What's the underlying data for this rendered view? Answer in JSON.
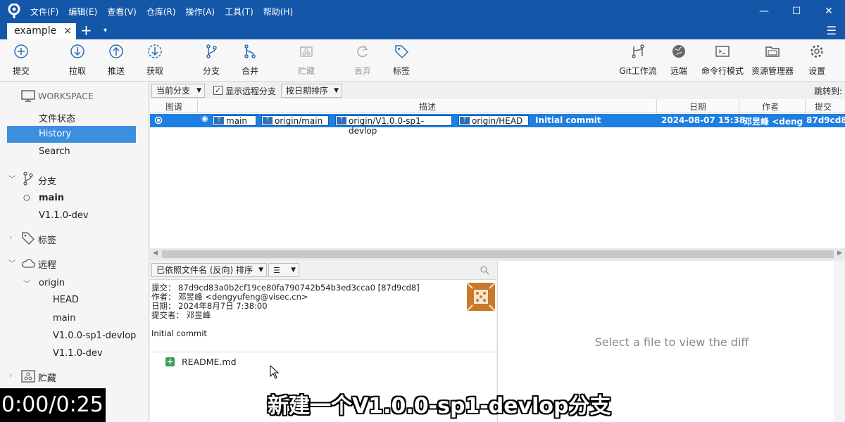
{
  "menu": [
    "文件(F)",
    "编辑(E)",
    "查看(V)",
    "仓库(R)",
    "操作(A)",
    "工具(T)",
    "帮助(H)"
  ],
  "tab": {
    "label": "example",
    "close": "×",
    "add": "+",
    "menu": "▾"
  },
  "toolbar": {
    "commit": "提交",
    "pull": "拉取",
    "push": "推送",
    "fetch": "获取",
    "branch": "分支",
    "merge": "合并",
    "stash": "贮藏",
    "discard": "丢弃",
    "tag": "标签",
    "gitflow": "Git工作流",
    "remote": "远端",
    "terminal": "命令行模式",
    "explorer": "资源管理器",
    "settings": "设置"
  },
  "sidebar": {
    "workspace": "WORKSPACE",
    "file_status": "文件状态",
    "history": "History",
    "search": "Search",
    "branches": "分支",
    "branch_items": [
      "main",
      "V1.1.0-dev"
    ],
    "tags": "标签",
    "remotes": "远程",
    "origin": "origin",
    "remote_items": [
      "HEAD",
      "main",
      "V1.0.0-sp1-devlop",
      "V1.1.0-dev"
    ],
    "stashes": "贮藏"
  },
  "filter": {
    "branch_select": "当前分支",
    "show_remote": "显示远程分支",
    "sort_select": "按日期排序",
    "jump_to": "跳转到:"
  },
  "grid": {
    "headers": {
      "graph": "图谱",
      "desc": "描述",
      "date": "日期",
      "author": "作者",
      "commit": "提交"
    },
    "row": {
      "refs": [
        "main",
        "origin/main",
        "origin/V1.0.0-sp1-devlop",
        "origin/HEAD"
      ],
      "message": "Initial commit",
      "date": "2024-08-07 15:38",
      "author": "邓昱峰 <deng",
      "hash": "87d9cd8"
    }
  },
  "details": {
    "sort_label": "已依照文件名 (反向) 排序",
    "commit_line": "提交： 87d9cd83a0b2cf19ce80fa790742b54b3ed3cca0 [87d9cd8]",
    "author_line": "作者： 邓昱峰 <dengyufeng@visec.cn>",
    "date_line": "日期： 2024年8月7日 7:38:00",
    "committer_line": "提交者： 邓昱峰",
    "message": "Initial commit",
    "file": "README.md"
  },
  "diff_placeholder": "Select a file to view the diff",
  "video": {
    "time": "0:00/0:25",
    "subtitle": "新建一个V1.0.0-sp1-devlop分支"
  },
  "colors": {
    "titlebar": "#1457a8",
    "selection": "#1e7fe0",
    "sidebar_selection": "#3c8fdf"
  }
}
